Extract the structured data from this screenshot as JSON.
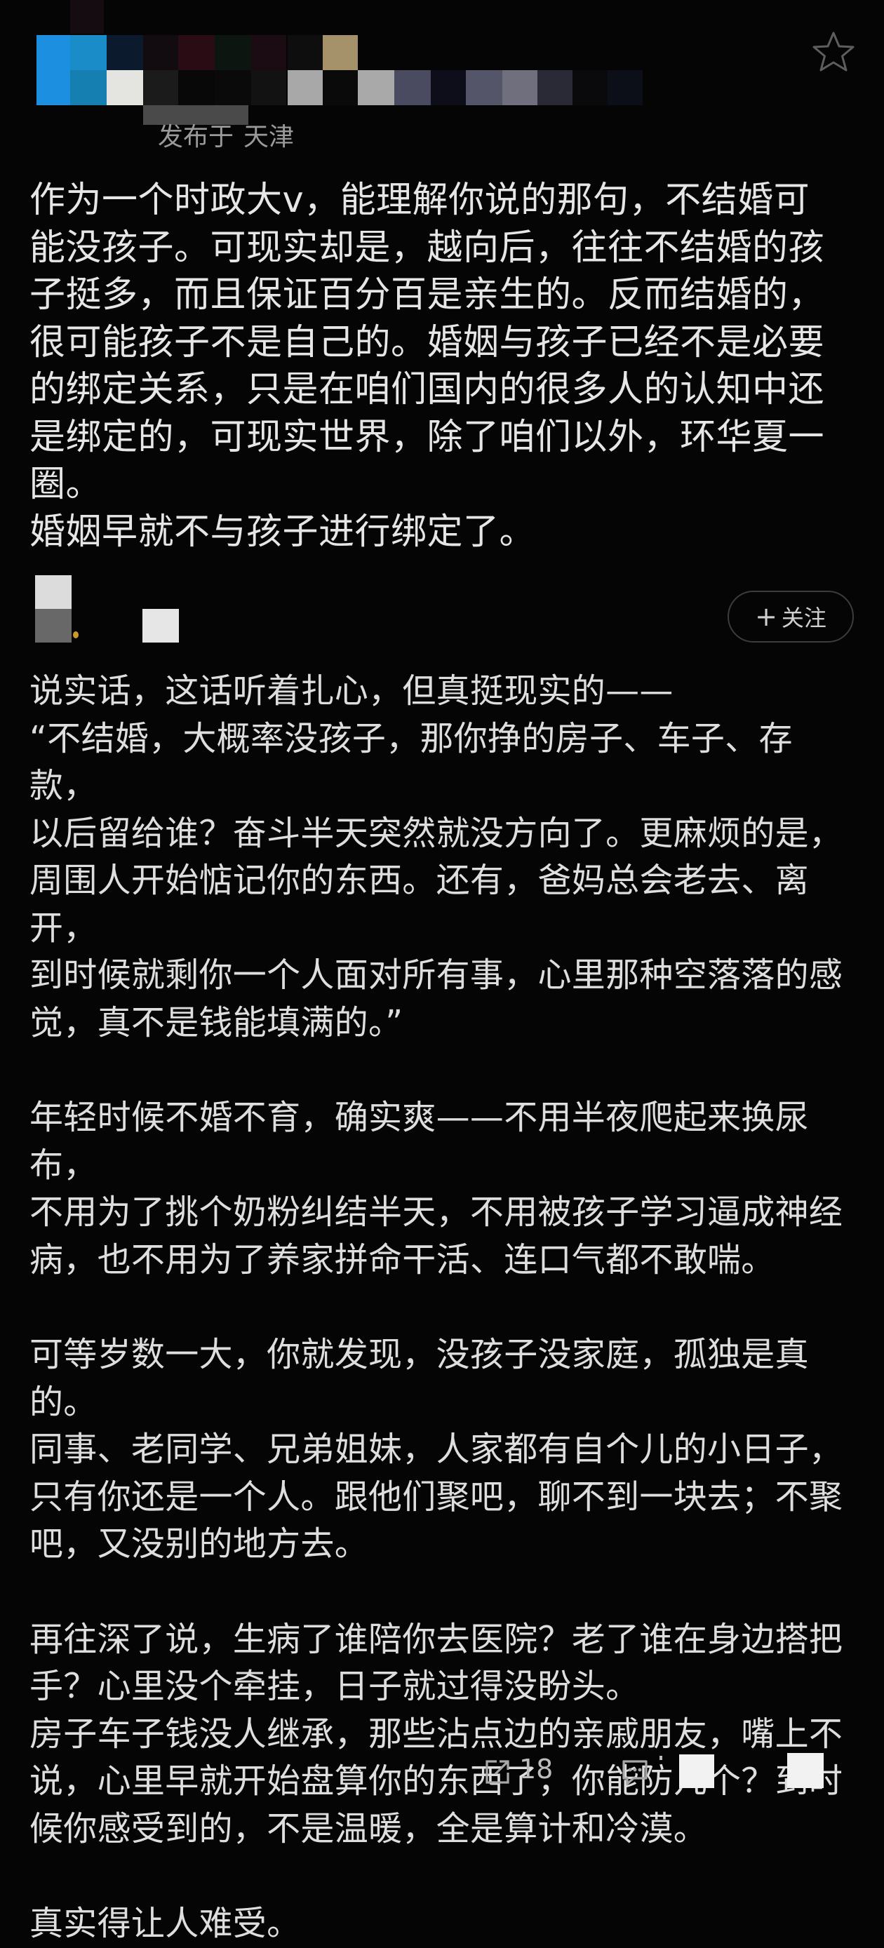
{
  "post": {
    "location": {
      "prefix": "发布于",
      "city": "天津"
    },
    "lines": [
      "作为一个时政大v，能理解你说的那句，不结婚可",
      "能没孩子。可现实却是，越向后，往往不结婚的孩",
      "子挺多，而且保证百分百是亲生的。反而结婚的，",
      "很可能孩子不是自己的。婚姻与孩子已经不是必要",
      "的绑定关系，只是在咱们国内的很多人的认知中还",
      "是绑定的，可现实世界，除了咱们以外，环华夏一圈。",
      "婚姻早就不与孩子进行绑定了。"
    ]
  },
  "reply": {
    "follow_label": "关注",
    "paragraphs": [
      [
        "说实话，这话听着扎心，但真挺现实的——",
        "“不结婚，大概率没孩子，那你挣的房子、车子、存款，",
        "以后留给谁？奋斗半天突然就没方向了。更麻烦的是，",
        "周围人开始惦记你的东西。还有，爸妈总会老去、离开，",
        "到时候就剩你一个人面对所有事，心里那种空落落的感",
        "觉，真不是钱能填满的。”"
      ],
      [
        "年轻时候不婚不育，确实爽——不用半夜爬起来换尿布，",
        "不用为了挑个奶粉纠结半天，不用被孩子学习逼成神经",
        "病，也不用为了养家拼命干活、连口气都不敢喘。"
      ],
      [
        "可等岁数一大，你就发现，没孩子没家庭，孤独是真的。",
        "同事、老同学、兄弟姐妹，人家都有自个儿的小日子，",
        "只有你还是一个人。跟他们聚吧，聊不到一块去；不聚",
        "吧，又没别的地方去。"
      ],
      [
        "再往深了说，生病了谁陪你去医院？老了谁在身边搭把",
        "手？心里没个牵挂，日子就过得没盼头。",
        "房子车子钱没人继承，那些沾点边的亲戚朋友，嘴上不",
        "说，心里早就开始盘算你的东西了，你能防几个？到时",
        "候你感受到的，不是温暖，全是算计和冷漠。"
      ],
      [
        "真实得让人难受。"
      ]
    ],
    "share_count": "18"
  },
  "icons": {
    "star": "star-icon",
    "follow_plus": "plus-icon",
    "share": "share-icon",
    "comment": "comment-icon"
  }
}
